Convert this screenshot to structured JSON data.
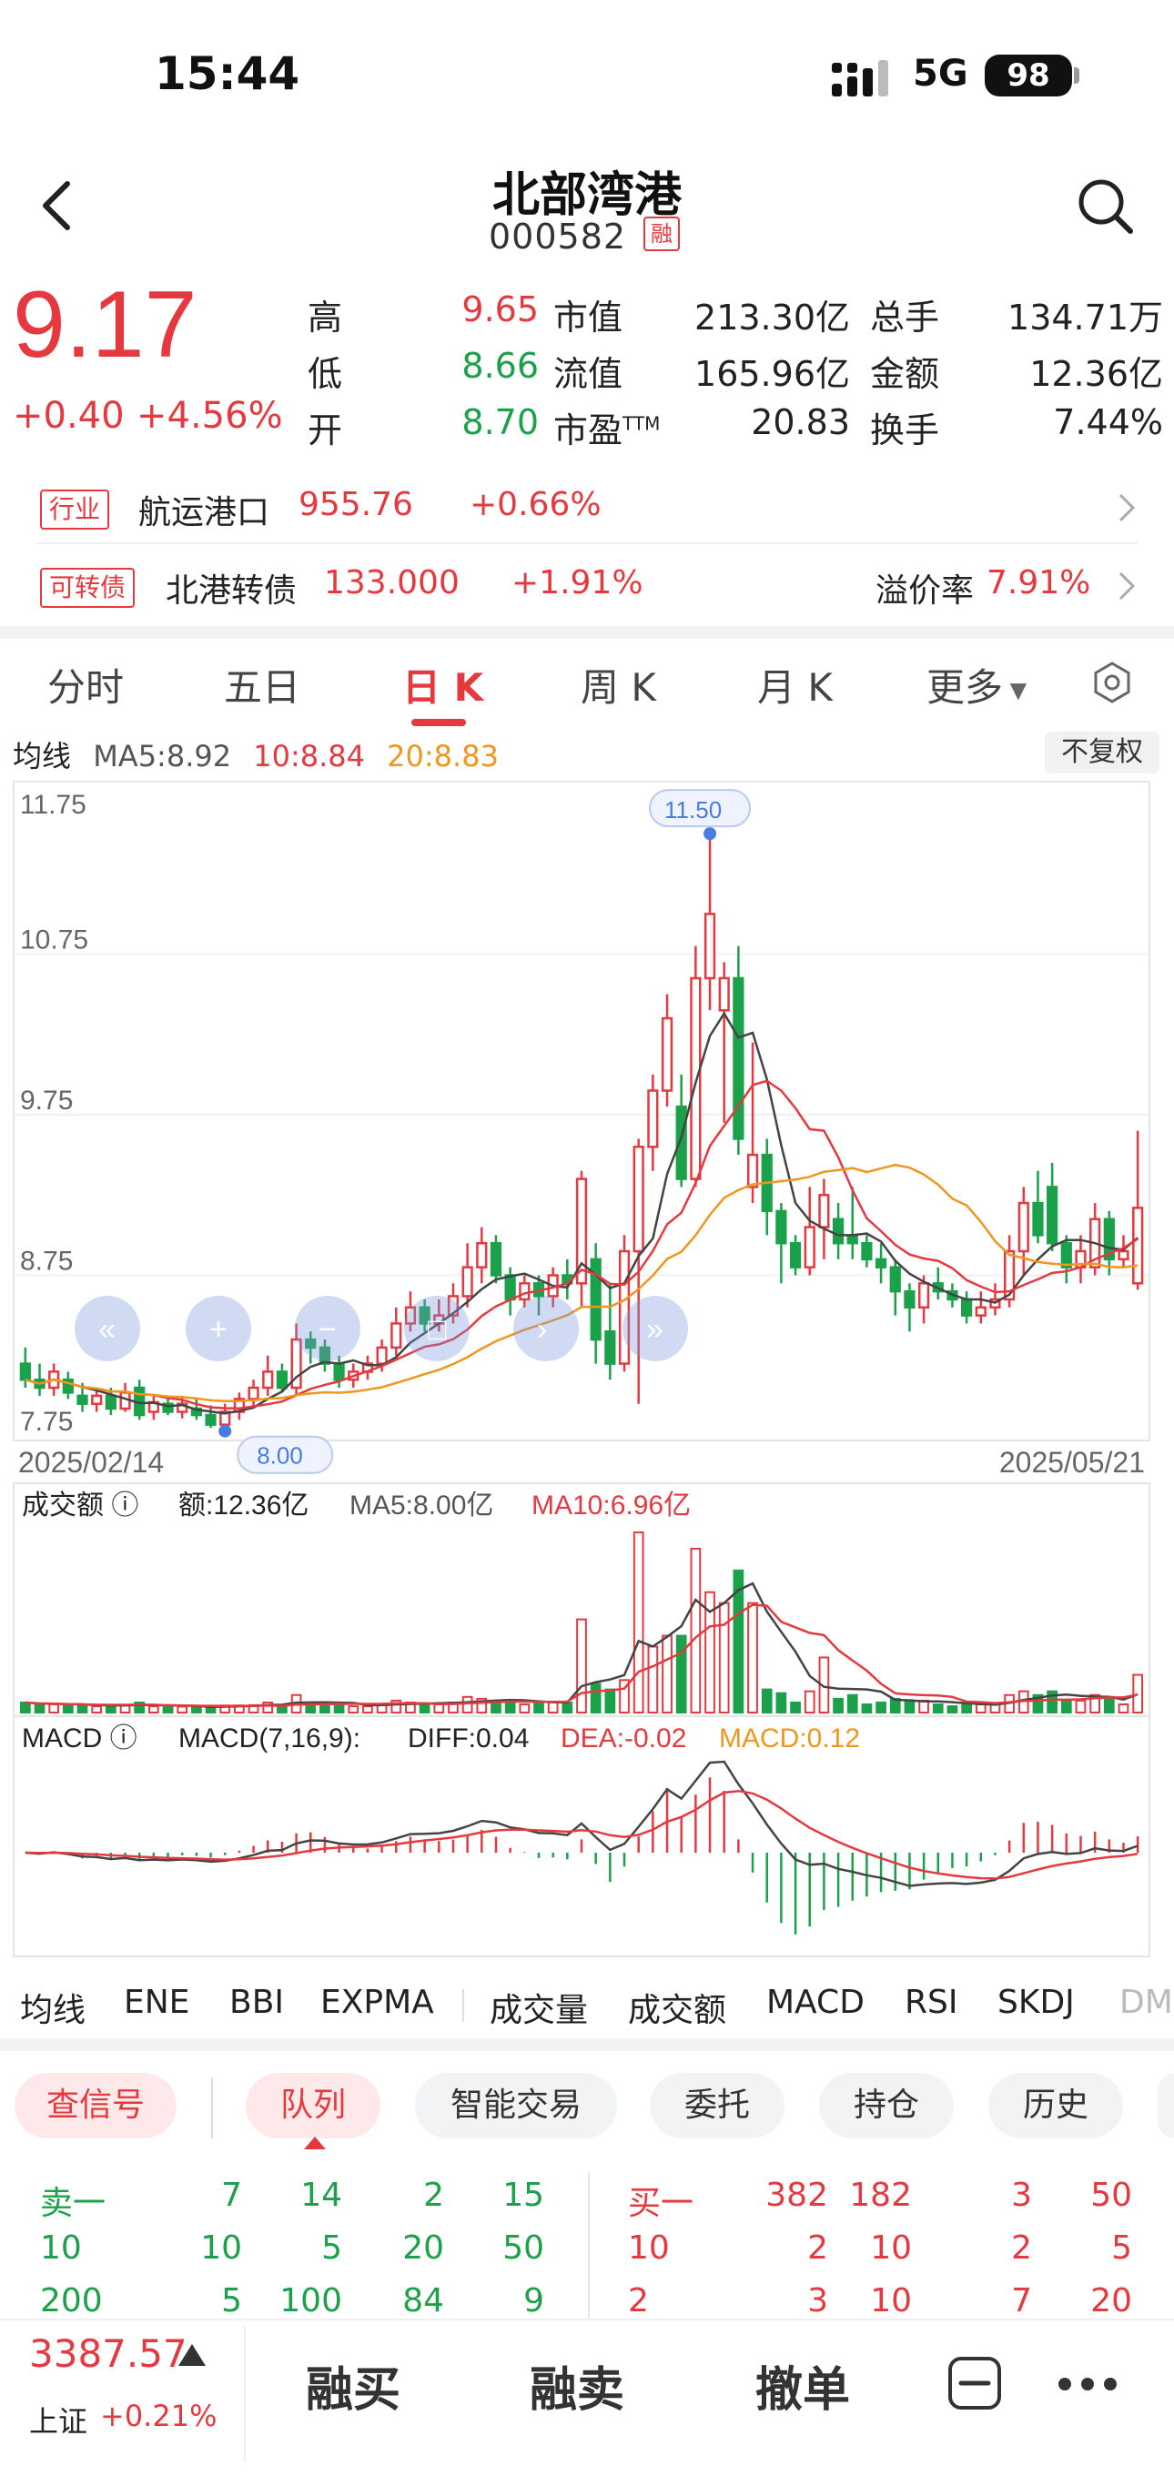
{
  "status_bar": {
    "time": "15:44",
    "network": "5G",
    "battery": "98"
  },
  "header": {
    "name": "北部湾港",
    "code": "000582",
    "badge": "融"
  },
  "quote": {
    "price": "9.17",
    "change": "+0.40",
    "change_pct": "+4.56%",
    "stats": [
      {
        "label": "高",
        "value": "9.65",
        "color": "red"
      },
      {
        "label": "市值",
        "value": "213.30亿",
        "color": "black"
      },
      {
        "label": "总手",
        "value": "134.71万",
        "color": "black"
      },
      {
        "label": "低",
        "value": "8.66",
        "color": "green"
      },
      {
        "label": "流值",
        "value": "165.96亿",
        "color": "black"
      },
      {
        "label": "金额",
        "value": "12.36亿",
        "color": "black"
      },
      {
        "label": "开",
        "value": "8.70",
        "color": "green"
      },
      {
        "label": "市盈TTM",
        "value": "20.83",
        "color": "black"
      },
      {
        "label": "换手",
        "value": "7.44%",
        "color": "black"
      }
    ]
  },
  "industry": {
    "tag": "行业",
    "name": "航运港口",
    "value": "955.76",
    "change": "+0.66%"
  },
  "bond": {
    "tag": "可转债",
    "name": "北港转债",
    "value": "133.000",
    "change": "+1.91%",
    "premium_label": "溢价率",
    "premium": "7.91%"
  },
  "tabs": [
    {
      "label": "分时"
    },
    {
      "label": "五日"
    },
    {
      "label": "日 K"
    },
    {
      "label": "周 K"
    },
    {
      "label": "月 K"
    },
    {
      "label": "更多"
    }
  ],
  "active_tab": 2,
  "ma_legend": {
    "title": "均线",
    "ma5": "MA5:8.92",
    "ma10": "10:8.84",
    "ma20": "20:8.83"
  },
  "restore_label": "不复权",
  "colors": {
    "up": "#e6393f",
    "down": "#1ba14a",
    "ma5": "#444444",
    "ma10": "#e6393f",
    "ma20": "#f0961e",
    "marker": "#4a7be0"
  },
  "chart_data": {
    "type": "candlestick",
    "y_ticks": [
      "11.75",
      "10.75",
      "9.75",
      "8.75",
      "7.75"
    ],
    "ylim": [
      7.75,
      11.75
    ],
    "x_start": "2025/02/14",
    "x_end": "2025/05/21",
    "max_label": "11.50",
    "min_label": "8.00",
    "candles": [
      [
        8.2,
        8.1,
        8.3,
        8.05
      ],
      [
        8.1,
        8.05,
        8.2,
        8.0
      ],
      [
        8.05,
        8.15,
        8.2,
        8.0
      ],
      [
        8.1,
        8.02,
        8.15,
        7.98
      ],
      [
        8.0,
        7.95,
        8.08,
        7.9
      ],
      [
        7.95,
        8.0,
        8.05,
        7.9
      ],
      [
        8.0,
        7.92,
        8.05,
        7.88
      ],
      [
        7.92,
        8.02,
        8.08,
        7.9
      ],
      [
        8.05,
        7.88,
        8.1,
        7.85
      ],
      [
        7.9,
        7.96,
        8.0,
        7.85
      ],
      [
        7.95,
        7.9,
        8.0,
        7.88
      ],
      [
        7.9,
        7.95,
        8.0,
        7.86
      ],
      [
        7.92,
        7.88,
        7.98,
        7.85
      ],
      [
        7.88,
        7.82,
        7.94,
        7.8
      ],
      [
        7.82,
        7.9,
        7.95,
        7.78
      ],
      [
        7.9,
        7.98,
        8.02,
        7.85
      ],
      [
        7.98,
        8.05,
        8.1,
        7.92
      ],
      [
        8.05,
        8.15,
        8.25,
        8.0
      ],
      [
        8.15,
        8.05,
        8.2,
        8.02
      ],
      [
        8.05,
        8.35,
        8.45,
        8.0
      ],
      [
        8.35,
        8.3,
        8.4,
        8.2
      ],
      [
        8.3,
        8.2,
        8.35,
        8.15
      ],
      [
        8.2,
        8.1,
        8.25,
        8.05
      ],
      [
        8.1,
        8.15,
        8.2,
        8.05
      ],
      [
        8.15,
        8.2,
        8.25,
        8.1
      ],
      [
        8.2,
        8.3,
        8.35,
        8.15
      ],
      [
        8.3,
        8.45,
        8.55,
        8.25
      ],
      [
        8.45,
        8.55,
        8.65,
        8.4
      ],
      [
        8.55,
        8.45,
        8.6,
        8.4
      ],
      [
        8.45,
        8.5,
        8.6,
        8.4
      ],
      [
        8.5,
        8.62,
        8.7,
        8.45
      ],
      [
        8.62,
        8.8,
        8.95,
        8.55
      ],
      [
        8.8,
        8.95,
        9.05,
        8.7
      ],
      [
        8.95,
        8.75,
        9.0,
        8.7
      ],
      [
        8.75,
        8.6,
        8.8,
        8.5
      ],
      [
        8.6,
        8.7,
        8.75,
        8.55
      ],
      [
        8.7,
        8.62,
        8.75,
        8.5
      ],
      [
        8.62,
        8.75,
        8.8,
        8.55
      ],
      [
        8.75,
        8.7,
        8.85,
        8.6
      ],
      [
        8.7,
        9.35,
        9.4,
        8.55
      ],
      [
        8.85,
        8.35,
        8.95,
        8.2
      ],
      [
        8.4,
        8.2,
        8.7,
        8.1
      ],
      [
        8.2,
        8.9,
        9.0,
        8.15
      ],
      [
        8.9,
        9.55,
        9.6,
        7.95
      ],
      [
        9.55,
        9.9,
        10.0,
        9.4
      ],
      [
        9.9,
        10.35,
        10.5,
        9.8
      ],
      [
        9.8,
        9.35,
        10.0,
        9.3
      ],
      [
        9.35,
        10.6,
        10.8,
        9.3
      ],
      [
        10.6,
        11.0,
        11.5,
        10.4
      ],
      [
        10.4,
        10.6,
        10.7,
        9.7
      ],
      [
        10.6,
        9.6,
        10.8,
        9.5
      ],
      [
        9.3,
        9.5,
        10.2,
        9.2
      ],
      [
        9.5,
        9.15,
        9.6,
        9.0
      ],
      [
        9.15,
        8.95,
        9.2,
        8.7
      ],
      [
        8.95,
        8.8,
        9.0,
        8.75
      ],
      [
        8.8,
        9.05,
        9.3,
        8.75
      ],
      [
        9.05,
        9.25,
        9.35,
        8.85
      ],
      [
        9.1,
        8.95,
        9.2,
        8.85
      ],
      [
        9.0,
        8.95,
        9.3,
        8.85
      ],
      [
        8.95,
        8.85,
        9.0,
        8.8
      ],
      [
        8.85,
        8.8,
        8.95,
        8.7
      ],
      [
        8.8,
        8.65,
        8.85,
        8.5
      ],
      [
        8.65,
        8.55,
        8.7,
        8.4
      ],
      [
        8.55,
        8.7,
        8.75,
        8.45
      ],
      [
        8.7,
        8.65,
        8.8,
        8.6
      ],
      [
        8.65,
        8.6,
        8.7,
        8.55
      ],
      [
        8.6,
        8.5,
        8.65,
        8.45
      ],
      [
        8.5,
        8.55,
        8.65,
        8.45
      ],
      [
        8.55,
        8.6,
        8.7,
        8.5
      ],
      [
        8.6,
        8.9,
        9.0,
        8.55
      ],
      [
        8.9,
        9.2,
        9.3,
        8.75
      ],
      [
        9.2,
        9.0,
        9.4,
        8.95
      ],
      [
        9.3,
        8.95,
        9.45,
        8.9
      ],
      [
        8.95,
        8.8,
        9.0,
        8.7
      ],
      [
        8.8,
        8.9,
        9.0,
        8.7
      ],
      [
        8.8,
        9.1,
        9.2,
        8.75
      ],
      [
        9.1,
        8.85,
        9.15,
        8.75
      ],
      [
        8.85,
        8.9,
        9.0,
        8.8
      ],
      [
        8.7,
        9.17,
        9.65,
        8.66
      ]
    ],
    "ma5_label": "MA5",
    "ma10_label": "MA10",
    "ma20_label": "MA20"
  },
  "volume": {
    "title": "成交额",
    "value": "额:12.36亿",
    "ma5": "MA5:8.00亿",
    "ma10": "MA10:6.96亿"
  },
  "macd": {
    "title": "MACD",
    "params": "MACD(7,16,9):",
    "diff": "DIFF:0.04",
    "dea": "DEA:-0.02",
    "macd": "MACD:0.12"
  },
  "indicator_tabs": [
    {
      "label": "均线",
      "active": true
    },
    {
      "label": "ENE",
      "active": false
    },
    {
      "label": "BBI",
      "active": false
    },
    {
      "label": "EXPMA",
      "active": false
    },
    {
      "label": "成交量",
      "active": false
    },
    {
      "label": "成交额",
      "active": true
    },
    {
      "label": "MACD",
      "active": true
    },
    {
      "label": "RSI",
      "active": false
    },
    {
      "label": "SKDJ",
      "active": false
    },
    {
      "label": "DM",
      "active": false
    }
  ],
  "actions": [
    {
      "label": "查信号"
    },
    {
      "label": "队列"
    },
    {
      "label": "智能交易"
    },
    {
      "label": "委托"
    },
    {
      "label": "持仓"
    },
    {
      "label": "历史"
    }
  ],
  "queue": {
    "sell_label": "卖一",
    "buy_label": "买一",
    "sell_rows": [
      [
        "7",
        "14",
        "2",
        "15"
      ],
      [
        "10",
        "10",
        "5",
        "20",
        "50"
      ],
      [
        "200",
        "5",
        "100",
        "84",
        "9"
      ]
    ],
    "buy_rows": [
      [
        "382",
        "182",
        "3",
        "50"
      ],
      [
        "10",
        "2",
        "10",
        "2",
        "5"
      ],
      [
        "2",
        "3",
        "10",
        "7",
        "20"
      ]
    ]
  },
  "index": {
    "value": "3387.57",
    "name": "上证",
    "pct": "+0.21%"
  },
  "bottom_buttons": [
    {
      "label": "融买"
    },
    {
      "label": "融卖"
    },
    {
      "label": "撤单"
    }
  ]
}
